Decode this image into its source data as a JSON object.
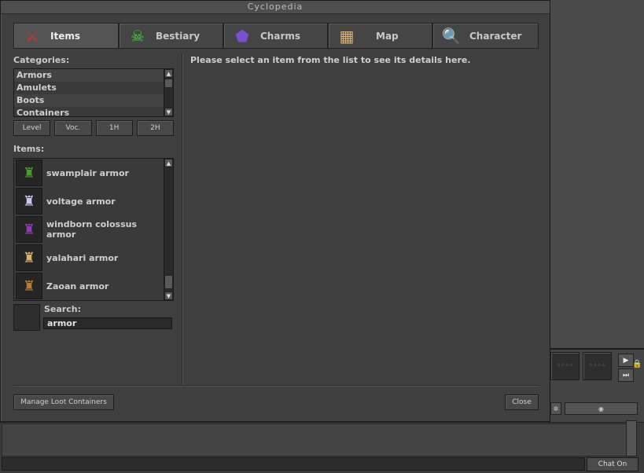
{
  "window": {
    "title": "Cyclopedia"
  },
  "tabs": [
    {
      "label": "Items",
      "icon": "items-icon",
      "active": true
    },
    {
      "label": "Bestiary",
      "icon": "bestiary-icon"
    },
    {
      "label": "Charms",
      "icon": "charms-icon"
    },
    {
      "label": "Map",
      "icon": "map-icon"
    },
    {
      "label": "Character",
      "icon": "character-icon"
    }
  ],
  "categories": {
    "label": "Categories:",
    "items": [
      "Armors",
      "Amulets",
      "Boots",
      "Containers"
    ]
  },
  "filters": [
    "Level",
    "Voc.",
    "1H",
    "2H"
  ],
  "items": {
    "label": "Items:",
    "list": [
      {
        "name": "swamplair armor",
        "icon": "swamplair-armor-icon",
        "color": "#3f7a2a"
      },
      {
        "name": "voltage armor",
        "icon": "voltage-armor-icon",
        "color": "#b9b9d8"
      },
      {
        "name": "windborn colossus armor",
        "icon": "windborn-colossus-armor-icon",
        "color": "#6a2f8a"
      },
      {
        "name": "yalahari armor",
        "icon": "yalahari-armor-icon",
        "color": "#c9a35a"
      },
      {
        "name": "Zaoan armor",
        "icon": "zaoan-armor-icon",
        "color": "#a3692a"
      }
    ]
  },
  "search": {
    "label": "Search:",
    "value": "armor"
  },
  "details": {
    "message": "Please select an item from the list to see its details here."
  },
  "footer": {
    "manage_label": "Manage Loot Containers",
    "close_label": "Close"
  },
  "chat": {
    "toggle_label": "Chat On"
  }
}
